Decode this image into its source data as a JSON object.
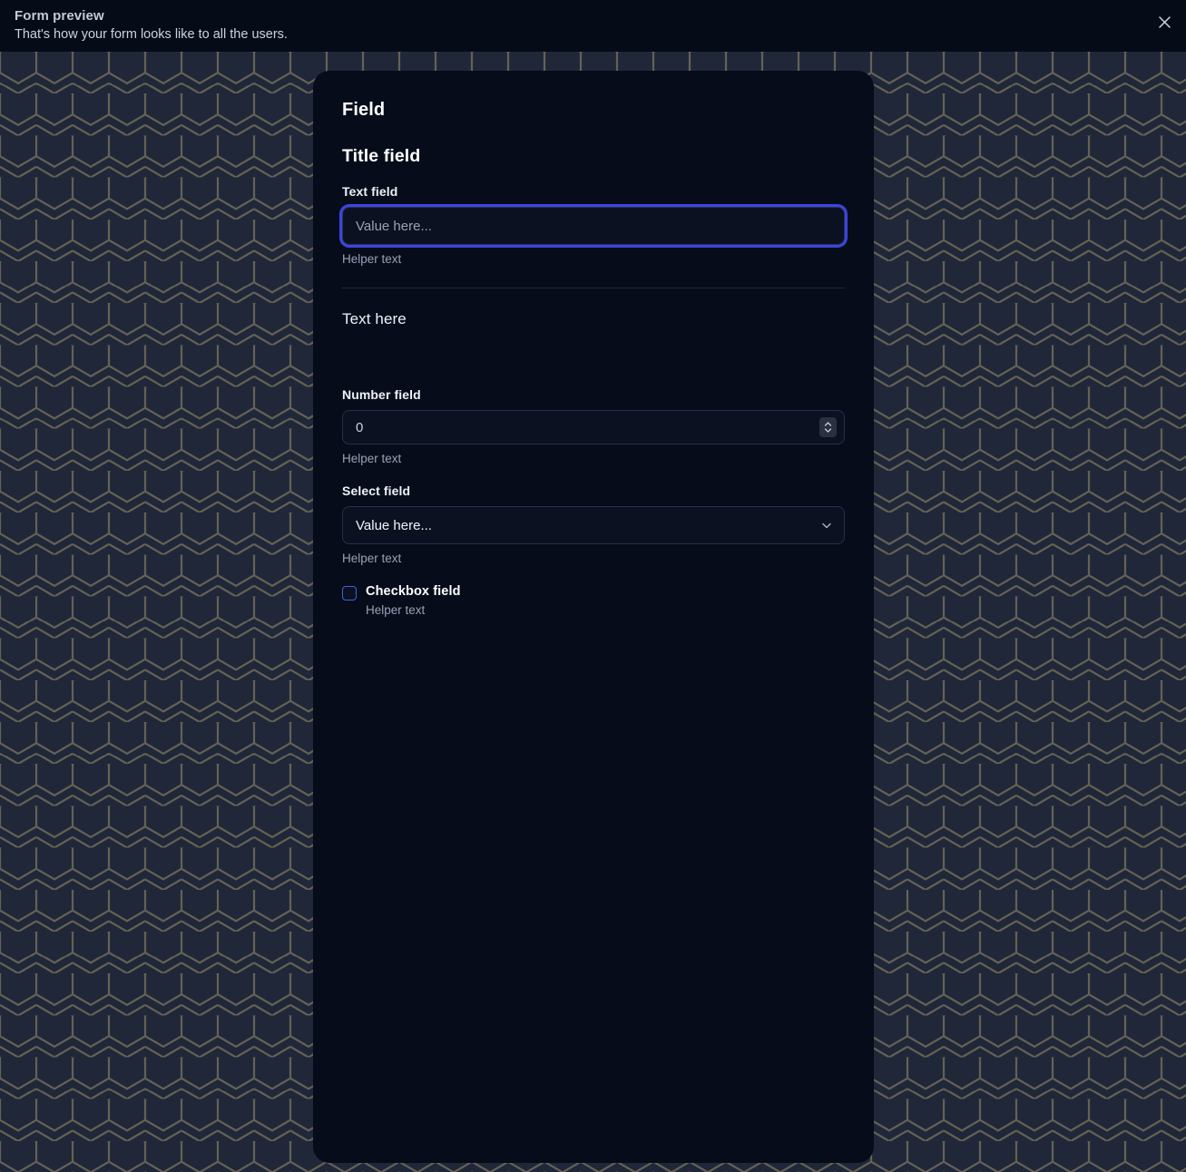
{
  "preview": {
    "title": "Form preview",
    "subtitle": "That's how your form looks like to all the users.",
    "close_icon": "close-icon"
  },
  "form": {
    "card_title": "Field",
    "section_title": "Title field",
    "text_field": {
      "label": "Text field",
      "value": "",
      "placeholder": "Value here...",
      "helper": "Helper text",
      "focused": true
    },
    "static_text": {
      "content": "Text here"
    },
    "number_field": {
      "label": "Number field",
      "value": "0",
      "helper": "Helper text",
      "spinner_icon": "spinner-up-down-icon"
    },
    "select_field": {
      "label": "Select field",
      "value": "Value here...",
      "helper": "Helper text",
      "chevron_icon": "chevron-down-icon"
    },
    "checkbox_field": {
      "label": "Checkbox field",
      "helper": "Helper text",
      "checked": false
    }
  },
  "colors": {
    "accent": "#3b45e0",
    "checkbox_border": "#3f62d8",
    "card_background": "#070c1a",
    "header_background": "#060b18",
    "backdrop": "#1f2739",
    "helper_text": "#99a2b5"
  }
}
